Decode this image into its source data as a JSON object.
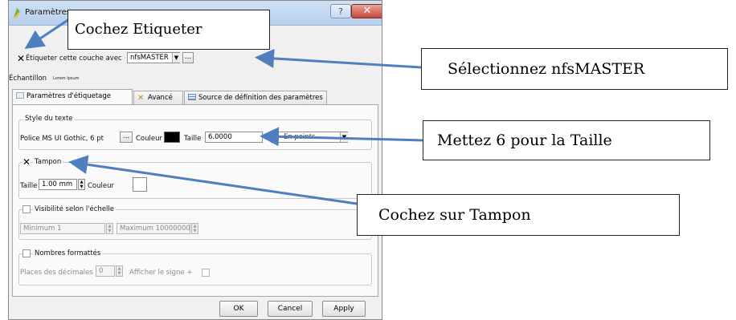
{
  "dialog": {
    "title": "Paramètres",
    "help_label": "?",
    "close_label": "✕",
    "label_layer_check": "✕",
    "label_layer_text": "Étiqueter cette couche avec",
    "label_field_value": "nfsMASTER",
    "expression_btn": "...",
    "sample_label": "Échantillon",
    "sample_text": "Lorem Ipsum",
    "tabs": [
      {
        "label": "Paramètres d'étiquetage",
        "icon": "label-settings-icon"
      },
      {
        "label": "Avancé",
        "icon": "tools-icon"
      },
      {
        "label": "Source de définition des paramètres",
        "icon": "table-icon"
      }
    ],
    "text_style": {
      "group_title": "Style du texte",
      "font_label": "Police MS UI Gothic, 6 pt",
      "font_btn": "...",
      "color_label": "Couleur",
      "color_value": "#000000",
      "size_label": "Taille",
      "size_value": "6.0000",
      "unit_value": "En points"
    },
    "buffer": {
      "check": "✕",
      "title": "Tampon",
      "size_label": "Taille",
      "size_value": "1.00 mm",
      "color_label": "Couleur",
      "color_value": "#ffffff"
    },
    "scale": {
      "title": "Visibilité selon l'échelle",
      "min_value": "Minimum 1",
      "max_value": "Maximum 10000000"
    },
    "numbers": {
      "title": "Nombres formattés",
      "decimals_label": "Places des décimales",
      "decimals_value": "0",
      "sign_label": "Afficher le signe +"
    },
    "buttons": {
      "ok": "OK",
      "cancel": "Cancel",
      "apply": "Apply"
    }
  },
  "callouts": {
    "c1": "Cochez Etiqueter",
    "c2": "Sélectionnez nfsMASTER",
    "c3": "Mettez 6 pour la Taille",
    "c4": "Cochez sur Tampon"
  },
  "colors": {
    "arrow": "#4f7fbf",
    "titlebar": "#bcd3ee",
    "close": "#c5483a"
  }
}
